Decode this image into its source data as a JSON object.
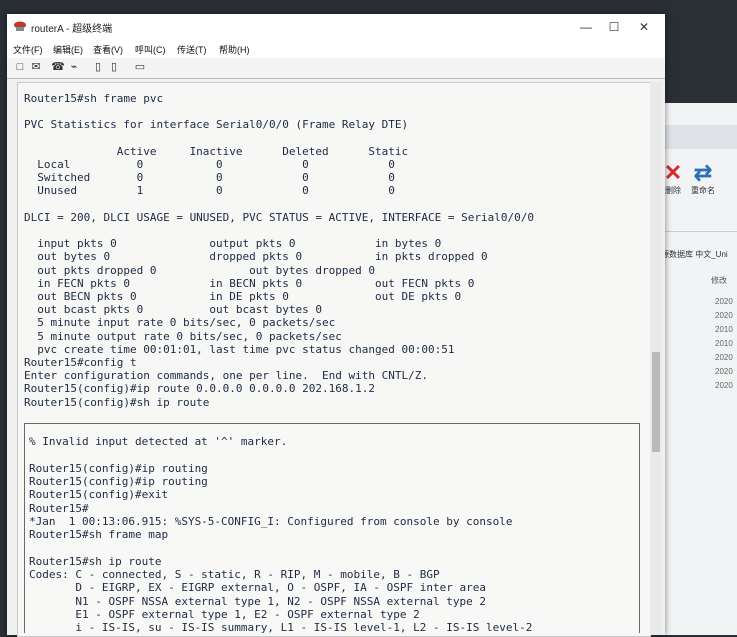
{
  "window": {
    "title": "routerA - 超级终端",
    "menu": [
      "文件(F)",
      "编辑(E)",
      "查看(V)",
      "呼叫(C)",
      "传送(T)",
      "帮助(H)"
    ],
    "controls": [
      "—",
      "☐",
      "✕"
    ]
  },
  "toolbar": [
    "□",
    "✉",
    "☎",
    "⌁",
    "▯",
    "▯",
    "▭"
  ],
  "terminal": {
    "top": [
      "Router15#sh frame pvc",
      "",
      "PVC Statistics for interface Serial0/0/0 (Frame Relay DTE)",
      "",
      "              Active     Inactive      Deleted      Static",
      "  Local          0           0            0            0",
      "  Switched       0           0            0            0",
      "  Unused         1           0            0            0",
      "",
      "DLCI = 200, DLCI USAGE = UNUSED, PVC STATUS = ACTIVE, INTERFACE = Serial0/0/0",
      "",
      "  input pkts 0              output pkts 0            in bytes 0",
      "  out bytes 0               dropped pkts 0           in pkts dropped 0",
      "  out pkts dropped 0              out bytes dropped 0",
      "  in FECN pkts 0            in BECN pkts 0           out FECN pkts 0",
      "  out BECN pkts 0           in DE pkts 0             out DE pkts 0",
      "  out bcast pkts 0          out bcast bytes 0",
      "  5 minute input rate 0 bits/sec, 0 packets/sec",
      "  5 minute output rate 0 bits/sec, 0 packets/sec",
      "  pvc create time 00:01:01, last time pvc status changed 00:00:51",
      "Router15#config t",
      "Enter configuration commands, one per line.  End with CNTL/Z.",
      "Router15(config)#ip route 0.0.0.0 0.0.0.0 202.168.1.2",
      "Router15(config)#sh ip route"
    ],
    "bottom": [
      "% Invalid input detected at '^' marker.",
      "",
      "Router15(config)#ip routing",
      "Router15(config)#ip routing",
      "Router15(config)#exit",
      "Router15#",
      "*Jan  1 00:13:06.915: %SYS-5-CONFIG_I: Configured from console by console",
      "Router15#sh frame map",
      "",
      "Router15#sh ip route",
      "Codes: C - connected, S - static, R - RIP, M - mobile, B - BGP",
      "       D - EIGRP, EX - EIGRP external, O - OSPF, IA - OSPF inter area",
      "       N1 - OSPF NSSA external type 1, N2 - OSPF NSSA external type 2",
      "       E1 - OSPF external type 1, E2 - OSPF external type 2",
      "       i - IS-IS, su - IS-IS summary, L1 - IS-IS level-1, L2 - IS-IS level-2"
    ]
  },
  "background_window": {
    "tools": [
      {
        "icon": "✕",
        "label": "删除",
        "color": "#d62b2b"
      },
      {
        "icon": "⇄",
        "label": "重命名",
        "color": "#2a6fb8"
      }
    ],
    "subtitle": "源数据库 中文_Uni",
    "column": "修改",
    "years": [
      "2020",
      "2020",
      "2010",
      "2010",
      "2020",
      "2020",
      "2020"
    ]
  }
}
